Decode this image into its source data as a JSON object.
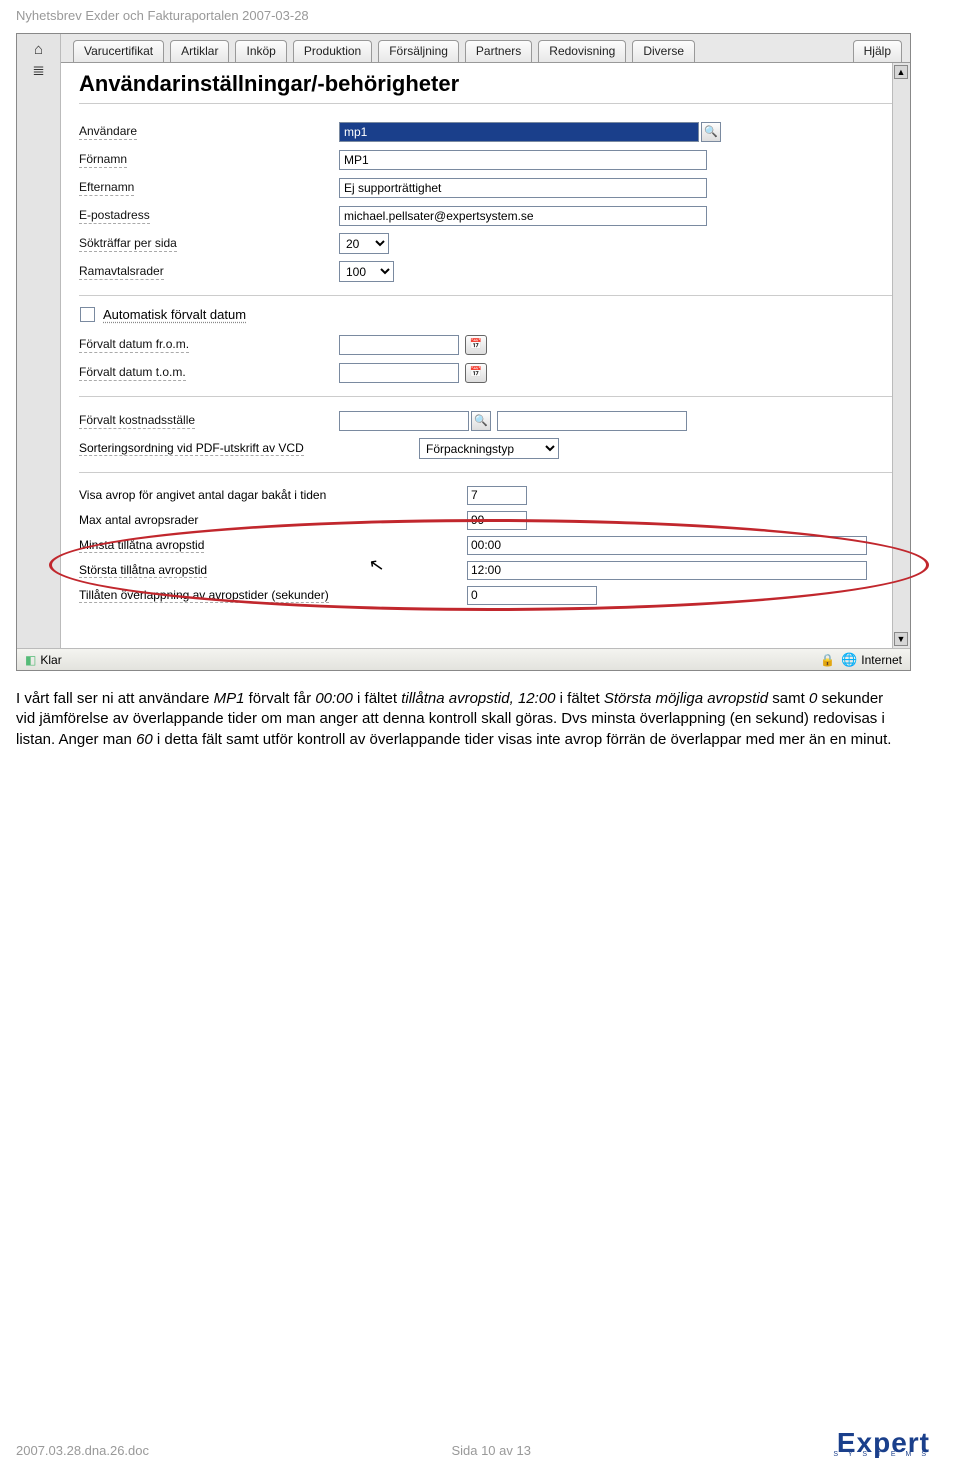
{
  "doc_header": "Nyhetsbrev Exder och Fakturaportalen 2007-03-28",
  "tabs": [
    "Varucertifikat",
    "Artiklar",
    "Inköp",
    "Produktion",
    "Försäljning",
    "Partners",
    "Redovisning",
    "Diverse",
    "Hjälp"
  ],
  "panel_title": "Användarinställningar/-behörigheter",
  "form": {
    "user_label": "Användare",
    "user_value": "mp1",
    "firstname_label": "Förnamn",
    "firstname_value": "MP1",
    "lastname_label": "Efternamn",
    "lastname_value": "Ej supporträttighet",
    "email_label": "E-postadress",
    "email_value": "michael.pellsater@expertsystem.se",
    "hits_label": "Sökträffar per sida",
    "hits_value": "20",
    "ramav_label": "Ramavtalsrader",
    "ramav_value": "100",
    "auto_date_label": "Automatisk förvalt datum",
    "date_from_label": "Förvalt datum fr.o.m.",
    "date_to_label": "Förvalt datum t.o.m.",
    "kostnad_label": "Förvalt kostnadsställe",
    "sort_label": "Sorteringsordning vid PDF-utskrift av VCD",
    "sort_value": "Förpackningstyp",
    "days_back_label": "Visa avrop för angivet antal dagar bakåt i tiden",
    "days_back_value": "7",
    "max_rows_label": "Max antal avropsrader",
    "max_rows_value": "99",
    "min_time_label": "Minsta tillåtna avropstid",
    "min_time_value": "00:00",
    "max_time_label": "Största tillåtna avropstid",
    "max_time_value": "12:00",
    "overlap_label": "Tillåten överlappning av avropstider (sekunder)",
    "overlap_value": "0"
  },
  "status": {
    "klar": "Klar",
    "zone": "Internet"
  },
  "paragraph": {
    "t1": "I vårt fall ser ni att användare ",
    "mp1": "MP1",
    "t2": " förvalt får ",
    "v0000": "00:00",
    "t3": " i fältet ",
    "tillatna": "tillåtna avropstid, 12:00",
    "t4": " i fältet ",
    "storsta": "Största möjliga avropstid",
    "t5": " samt ",
    "zero": "0",
    "t6": " sekunder vid jämförelse av överlappande tider om man anger att denna kontroll skall göras. Dvs minsta  överlappning (en sekund) redovisas i listan. Anger man ",
    "sixty": "60",
    "t7": " i detta fält samt utför kontroll av överlappande tider visas inte avrop förrän de överlappar med mer än en minut."
  },
  "footer": {
    "file": "2007.03.28.dna.26.doc",
    "page": "Sida 10 av 13",
    "logo_main": "Expert",
    "logo_sub": "S Y S T E M S"
  }
}
